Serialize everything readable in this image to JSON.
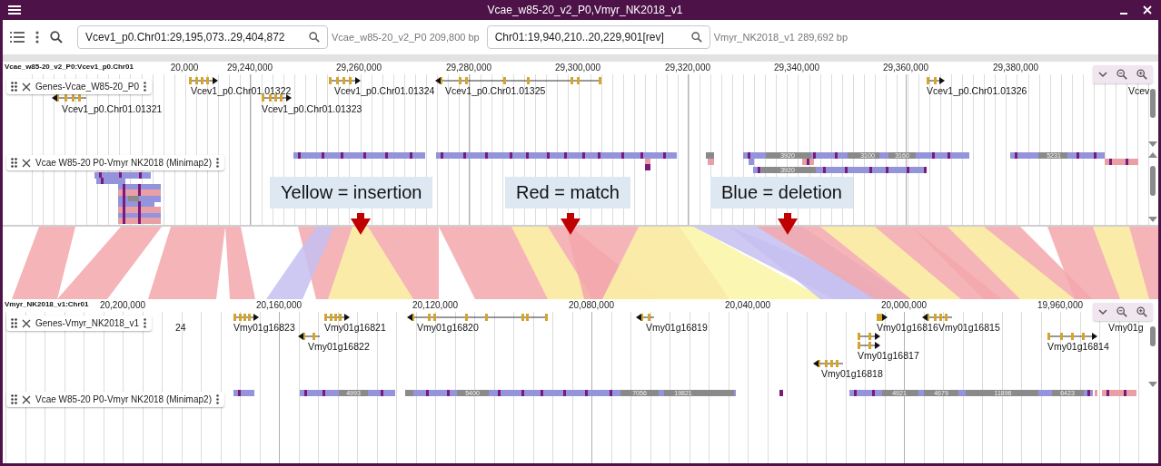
{
  "window": {
    "title": "Vcae_w85-20_v2_P0,Vmyr_NK2018_v1"
  },
  "locations": [
    {
      "value": "Vcev1_p0.Chr01:29,195,073..29,404,872",
      "info": "Vcae_w85-20_v2_P0 209,800 bp"
    },
    {
      "value": "Chr01:19,940,210..20,229,901[rev]",
      "info": "Vmyr_NK2018_v1 289,692 bp"
    }
  ],
  "views": [
    {
      "assembly_label": "Vcae_w85-20_v2_P0:Vcev1_p0.Chr01",
      "ruler_ticks": [
        "20,000",
        "29,240,000",
        "29,260,000",
        "29,280,000",
        "29,300,000",
        "29,320,000",
        "29,340,000",
        "29,360,000",
        "29,380,000"
      ],
      "gene_track": {
        "name": "Genes-Vcae_W85-20_P0",
        "genes": [
          {
            "label": "Vcev1_p0.Chr01.01321",
            "reverse": true
          },
          {
            "label": "Vcev1_p0.Chr01.01322",
            "reverse": false
          },
          {
            "label": "Vcev1_p0.Chr01.01323",
            "reverse": false
          },
          {
            "label": "Vcev1_p0.Chr01.01324",
            "reverse": false
          },
          {
            "label": "Vcev1_p0.Chr01.01325",
            "reverse": true
          },
          {
            "label": "Vcev1_p0.Chr01.01326",
            "reverse": false
          },
          {
            "label": "Vcev"
          }
        ]
      },
      "alignment_track": {
        "name": "Vcae W85-20 P0-Vmyr NK2018 (Minimap2)",
        "bar_labels": [
          "3920",
          "3100",
          "3160",
          "5231",
          "3920"
        ]
      }
    },
    {
      "assembly_label": "Vmyr_NK2018_v1:Chr01",
      "ruler_ticks": [
        "20,200,000",
        "20,160,000",
        "20,120,000",
        "20,080,000",
        "20,040,000",
        "20,000,000",
        "19,960,000"
      ],
      "gene_track": {
        "name": "Genes-Vmyr_NK2018_v1",
        "genes": [
          {
            "label": "24"
          },
          {
            "label": "Vmy01g16823",
            "reverse": false
          },
          {
            "label": "Vmy01g16821",
            "reverse": false
          },
          {
            "label": "Vmy01g16822",
            "reverse": true
          },
          {
            "label": "Vmy01g16820",
            "reverse": true
          },
          {
            "label": "Vmy01g16819",
            "reverse": true
          },
          {
            "label": "Vmy01g16816",
            "reverse": false
          },
          {
            "label": "Vmy01g16815",
            "reverse": true
          },
          {
            "label": "Vmy01g16817",
            "reverse": false
          },
          {
            "label": "Vmy01g16818",
            "reverse": true
          },
          {
            "label": "Vmy01g16814",
            "reverse": false
          },
          {
            "label": "Vmy01g"
          }
        ]
      },
      "alignment_track": {
        "name": "Vcae W85-20 P0-Vmyr NK2018 (Minimap2)",
        "bar_labels": [
          "4993",
          "5400",
          "7056",
          "19821",
          "4921",
          "4679",
          "11896",
          "6423"
        ]
      }
    }
  ],
  "annotations": [
    {
      "text": "Yellow = insertion"
    },
    {
      "text": "Red = match"
    },
    {
      "text": "Blue = deletion"
    }
  ]
}
